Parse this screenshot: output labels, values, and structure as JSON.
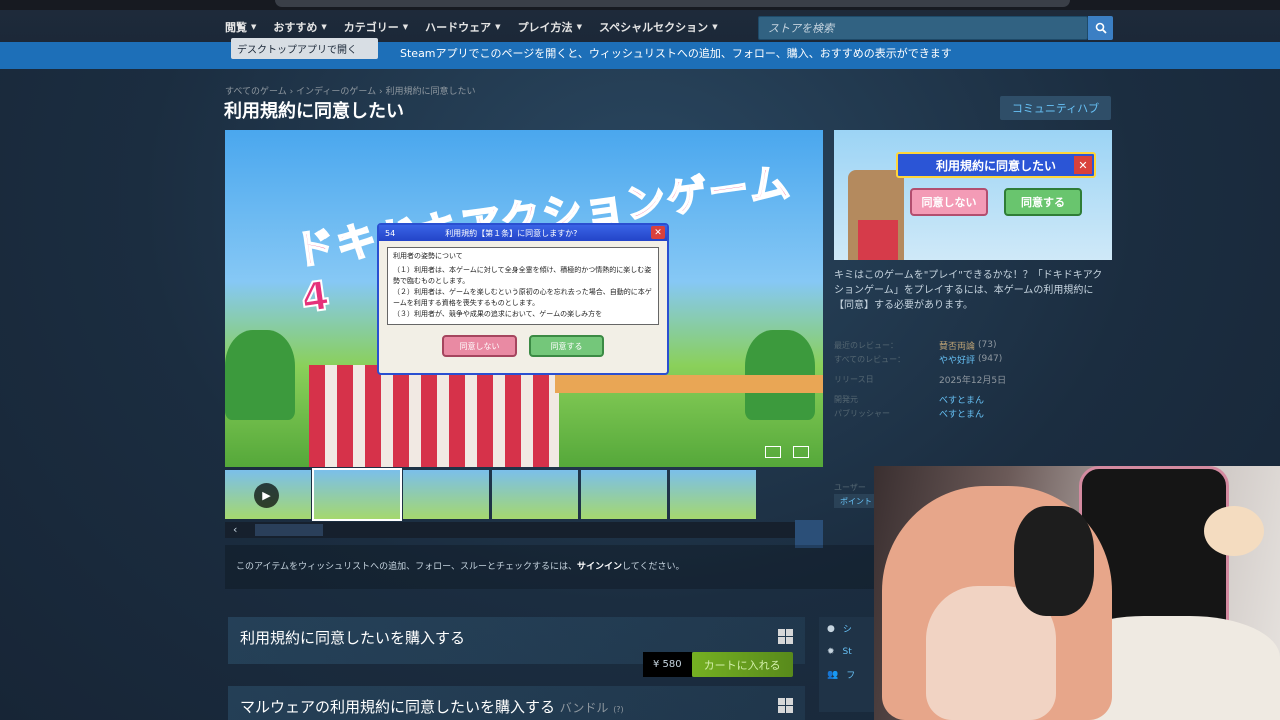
{
  "nav": {
    "items": [
      "閲覧",
      "おすすめ",
      "カテゴリー",
      "ハードウェア",
      "プレイ方法",
      "スペシャルセクション"
    ],
    "search_placeholder": "ストアを検索"
  },
  "banner": {
    "open_button": "デスクトップアプリで開く",
    "message": "Steamアプリでこのページを開くと、ウィッシュリストへの追加、フォロー、購入、おすすめの表示ができます"
  },
  "breadcrumb": "すべてのゲーム › インディーのゲーム › 利用規約に同意したい",
  "page_title": "利用規約に同意したい",
  "community_hub": "コミュニティハブ",
  "screenshot": {
    "logo_text": "ドキドキアクションゲーム4",
    "dialog_number": "54",
    "dialog_title": "利用規約【第１条】に同意しますか?",
    "dialog_heading": "利用者の姿勢について",
    "dialog_lines": [
      "（１）利用者は、本ゲームに対して全身全霊を傾け、積極的かつ情熱的に楽しむ姿勢で臨むものとします。",
      "（２）利用者は、ゲームを楽しむという原初の心を忘れ去った場合、自動的に本ゲームを利用する資格を喪失するものとします。",
      "（３）利用者が、競争や成果の追求において、ゲームの楽しみ方を"
    ],
    "btn_disagree": "同意しない",
    "btn_agree": "同意する"
  },
  "capsule": {
    "title": "利用規約に同意したい",
    "btn_disagree": "同意しない",
    "btn_agree": "同意する"
  },
  "description": "キミはこのゲームを\"プレイ\"できるかな！？「ドキドキアクションゲーム」をプレイするには、本ゲームの利用規約に【同意】する必要があります。",
  "info": {
    "recent_reviews_label": "最近のレビュー：",
    "recent_reviews_value": "賛否両論",
    "recent_reviews_count": "(73)",
    "all_reviews_label": "すべてのレビュー：",
    "all_reviews_value": "やや好評",
    "all_reviews_count": "(947)",
    "release_label": "リリース日",
    "release_value": "2025年12月5日",
    "developer_label": "開発元",
    "developer_value": "べすとまん",
    "publisher_label": "パブリッシャー",
    "publisher_value": "べすとまん"
  },
  "tags_label": "ユーザー",
  "tag_first": "ポイント",
  "signin_text_before": "このアイテムをウィッシュリストへの追加、フォロー、スルーとチェックするには、",
  "signin_link": "サインイン",
  "signin_text_after": "してください。",
  "purchase1": {
    "title": "利用規約に同意したいを購入する",
    "price": "¥ 580",
    "cart": "カートに入れる"
  },
  "purchase2": {
    "title": "マルウェアの利用規約に同意したいを購入する",
    "suffix": "バンドル",
    "count": "(?)"
  },
  "side_links": [
    "シ",
    "St",
    "フ"
  ]
}
